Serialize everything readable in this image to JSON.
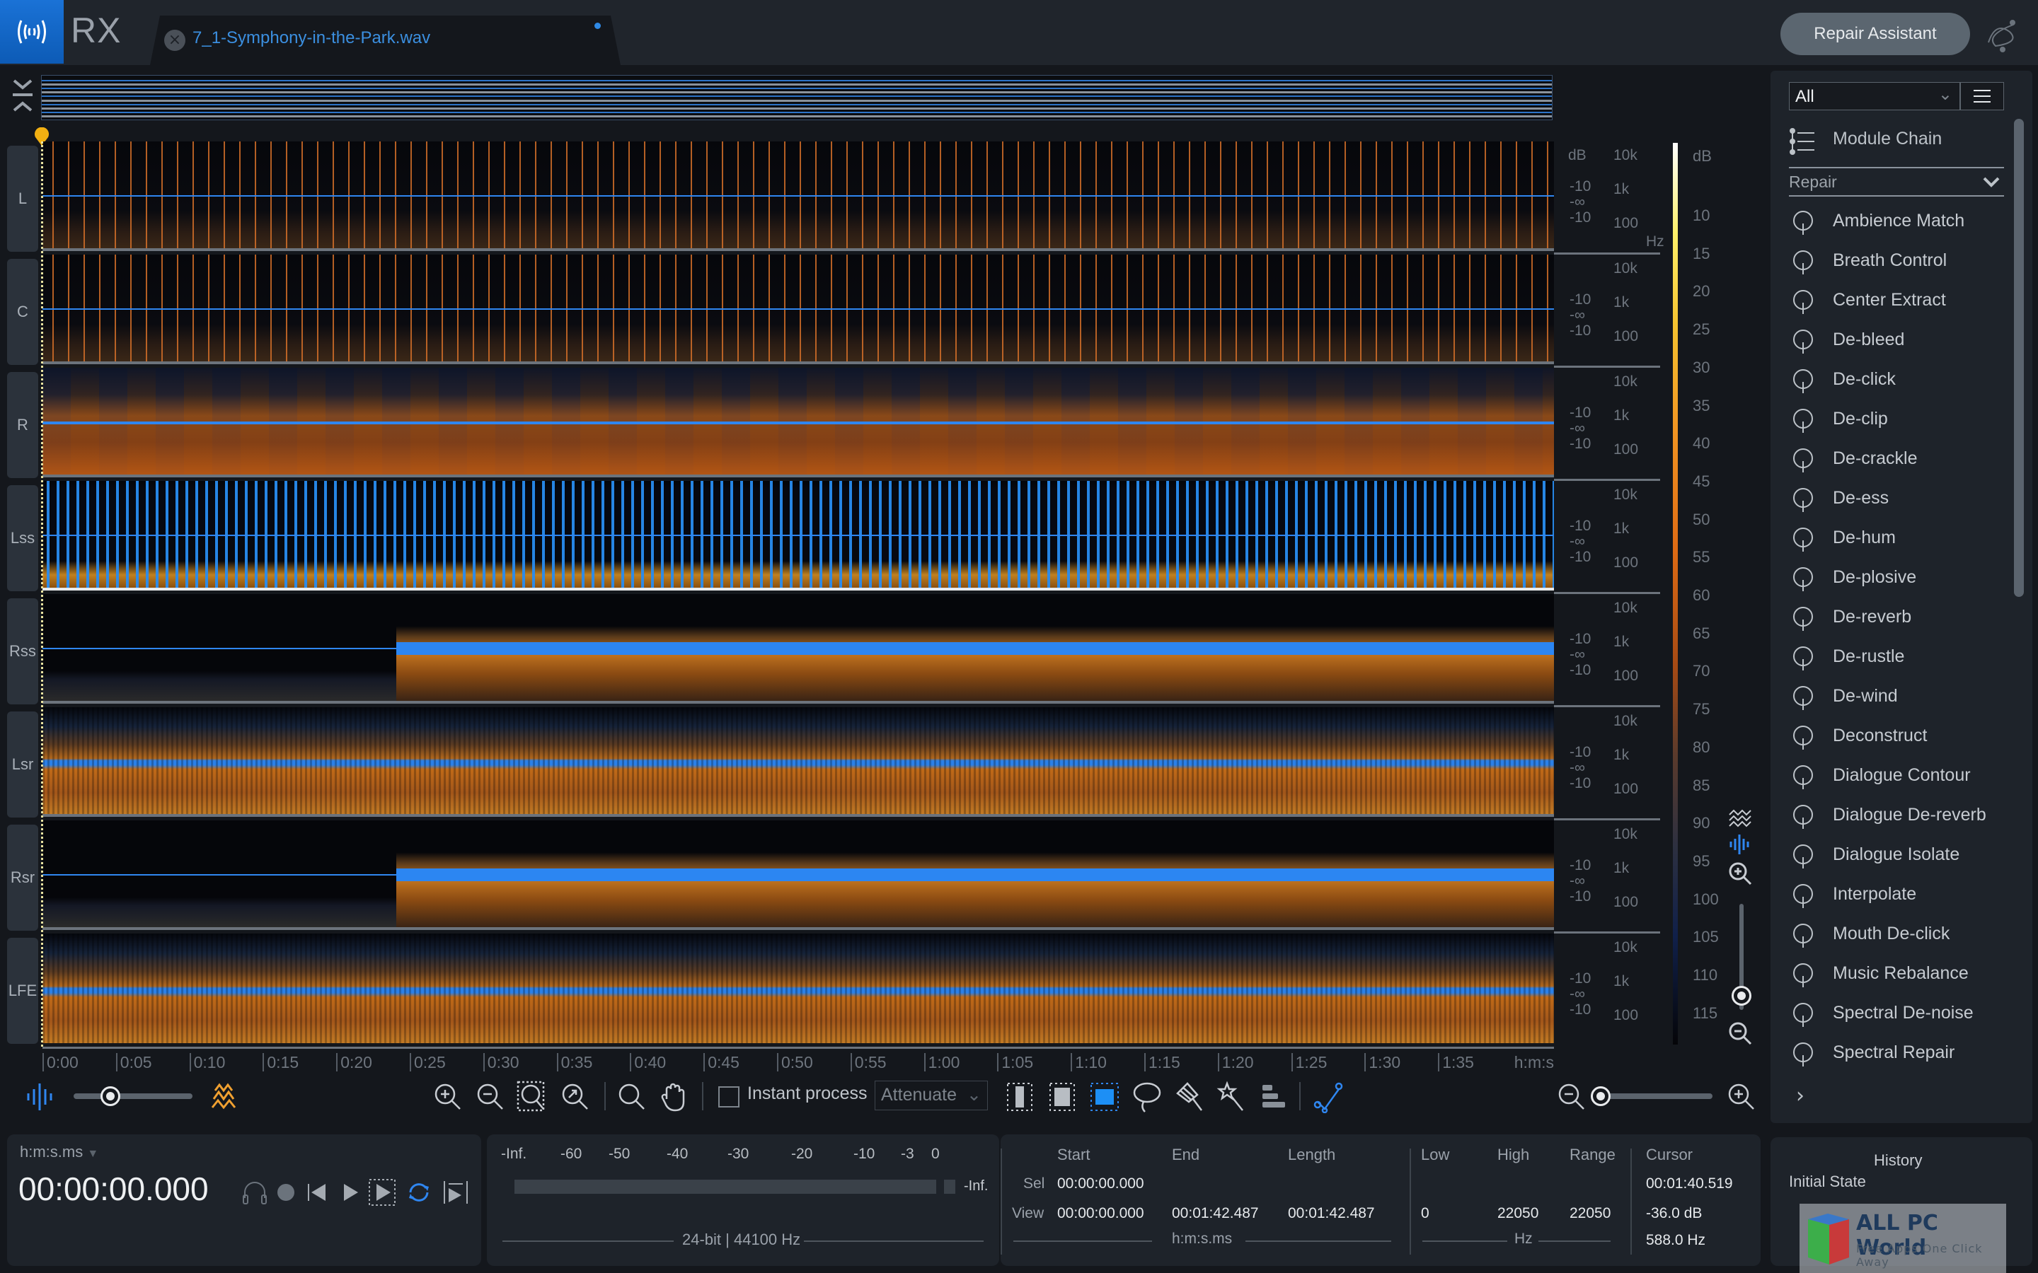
{
  "app": {
    "name": "RX",
    "file_tab": "7_1-Symphony-in-the-Park.wav",
    "repair_assistant_label": "Repair Assistant",
    "accent_color": "#2f86f0",
    "warm_color": "#e08a1e"
  },
  "channels": [
    {
      "label": "L"
    },
    {
      "label": "C"
    },
    {
      "label": "R"
    },
    {
      "label": "Lss"
    },
    {
      "label": "Rss"
    },
    {
      "label": "Lsr"
    },
    {
      "label": "Rsr"
    },
    {
      "label": "LFE"
    }
  ],
  "scales": {
    "db_unit": "dB",
    "hz_unit": "Hz",
    "db_ticks": [
      "-10",
      "-∞",
      "-10"
    ],
    "hz_ticks": [
      "10k",
      "1k",
      "100"
    ],
    "colorbar_unit": "dB",
    "colorbar_ticks": [
      "10",
      "15",
      "20",
      "25",
      "30",
      "35",
      "40",
      "45",
      "50",
      "55",
      "60",
      "65",
      "70",
      "75",
      "80",
      "85",
      "90",
      "95",
      "100",
      "105",
      "110",
      "115"
    ]
  },
  "timeline": {
    "ticks": [
      "0:00",
      "0:05",
      "0:10",
      "0:15",
      "0:20",
      "0:25",
      "0:30",
      "0:35",
      "0:40",
      "0:45",
      "0:50",
      "0:55",
      "1:00",
      "1:05",
      "1:10",
      "1:15",
      "1:20",
      "1:25",
      "1:30",
      "1:35"
    ],
    "unit": "h:m:s"
  },
  "toolbar": {
    "instant_process_label": "Instant process",
    "instant_process_checked": false,
    "mode_select_value": "Attenuate",
    "spectrogram_waveform_blend": 0.3,
    "horizontal_zoom": 0.0,
    "vertical_zoom": 0.12
  },
  "module_panel": {
    "filter_value": "All",
    "module_chain_label": "Module Chain",
    "category_label": "Repair",
    "modules": [
      {
        "label": "Ambience Match",
        "icon": "tree-icon"
      },
      {
        "label": "Breath Control",
        "icon": "breath-face-icon"
      },
      {
        "label": "Center Extract",
        "icon": "venn-circles-icon"
      },
      {
        "label": "De-bleed",
        "icon": "microphone-icon"
      },
      {
        "label": "De-click",
        "icon": "click-burst-icon"
      },
      {
        "label": "De-clip",
        "icon": "clip-bars-icon"
      },
      {
        "label": "De-crackle",
        "icon": "crackle-icon"
      },
      {
        "label": "De-ess",
        "icon": "ess-face-icon"
      },
      {
        "label": "De-hum",
        "icon": "hum-circle-icon"
      },
      {
        "label": "De-plosive",
        "icon": "plosive-face-icon"
      },
      {
        "label": "De-reverb",
        "icon": "reverb-rings-icon"
      },
      {
        "label": "De-rustle",
        "icon": "leaves-icon"
      },
      {
        "label": "De-wind",
        "icon": "wind-icon"
      },
      {
        "label": "Deconstruct",
        "icon": "puzzle-icon"
      },
      {
        "label": "Dialogue Contour",
        "icon": "speech-contour-icon"
      },
      {
        "label": "Dialogue De-reverb",
        "icon": "speech-reverb-icon"
      },
      {
        "label": "Dialogue Isolate",
        "icon": "speech-isolate-icon"
      },
      {
        "label": "Interpolate",
        "icon": "interpolate-curve-icon"
      },
      {
        "label": "Mouth De-click",
        "icon": "lips-icon"
      },
      {
        "label": "Music Rebalance",
        "icon": "music-scale-icon"
      },
      {
        "label": "Spectral De-noise",
        "icon": "noise-zigzag-icon"
      },
      {
        "label": "Spectral Repair",
        "icon": "plus-box-icon"
      }
    ]
  },
  "transport": {
    "time_format": "h:m:s.ms",
    "time": "00:00:00.000"
  },
  "meter": {
    "ticks": [
      "-Inf.",
      "-60",
      "-50",
      "-40",
      "-30",
      "-20",
      "-10",
      "-3",
      "0"
    ],
    "peak_value": "-Inf.",
    "format": "24-bit | 44100 Hz"
  },
  "selection": {
    "headers": {
      "start": "Start",
      "end": "End",
      "length": "Length",
      "low": "Low",
      "high": "High",
      "range": "Range",
      "cursor": "Cursor"
    },
    "sel": {
      "label": "Sel",
      "start": "00:00:00.000"
    },
    "view": {
      "label": "View",
      "start": "00:00:00.000",
      "end": "00:01:42.487",
      "length": "00:01:42.487",
      "low": "0",
      "high": "22050",
      "range": "22050"
    },
    "time_unit": "h:m:s.ms",
    "freq_unit": "Hz",
    "cursor": {
      "time": "00:01:40.519",
      "level": "-36.0 dB",
      "freq": "588.0 Hz"
    }
  },
  "history": {
    "title": "History",
    "items": [
      "Initial State"
    ]
  },
  "watermark": {
    "title": "ALL PC World",
    "subtitle": "Free Apps One Click Away"
  }
}
